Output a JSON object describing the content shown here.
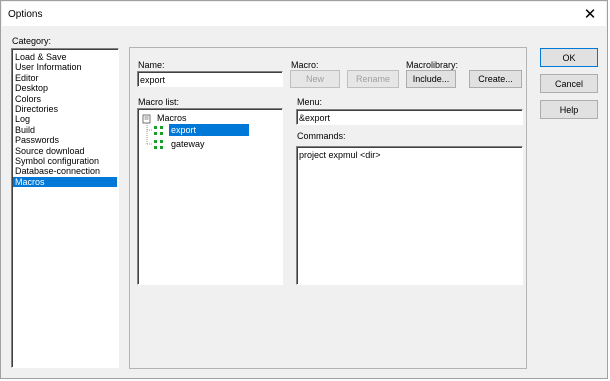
{
  "window": {
    "title": "Options",
    "close_glyph": "✕"
  },
  "category": {
    "label": "Category:",
    "items": [
      "Load & Save",
      "User Information",
      "Editor",
      "Desktop",
      "Colors",
      "Directories",
      "Log",
      "Build",
      "Passwords",
      "Source download",
      "Symbol configuration",
      "Database-connection",
      "Macros"
    ],
    "selected": "Macros"
  },
  "name": {
    "label": "Name:",
    "value": "export"
  },
  "macro": {
    "label": "Macro:",
    "new_label": "New",
    "rename_label": "Rename"
  },
  "macrolibrary": {
    "label": "Macrolibrary:",
    "include_label": "Include...",
    "create_label": "Create..."
  },
  "macro_list": {
    "label": "Macro list:",
    "root": "Macros",
    "items": [
      "export",
      "gateway"
    ],
    "selected": "export"
  },
  "menu": {
    "label": "Menu:",
    "value": "&export"
  },
  "commands": {
    "label": "Commands:",
    "value": "project expmul <dir>"
  },
  "buttons": {
    "ok": "OK",
    "cancel": "Cancel",
    "help": "Help"
  },
  "colors": {
    "selection": "#0078d7",
    "window_bg": "#f0f0f0",
    "macro_icon": "#1a9e2a"
  }
}
